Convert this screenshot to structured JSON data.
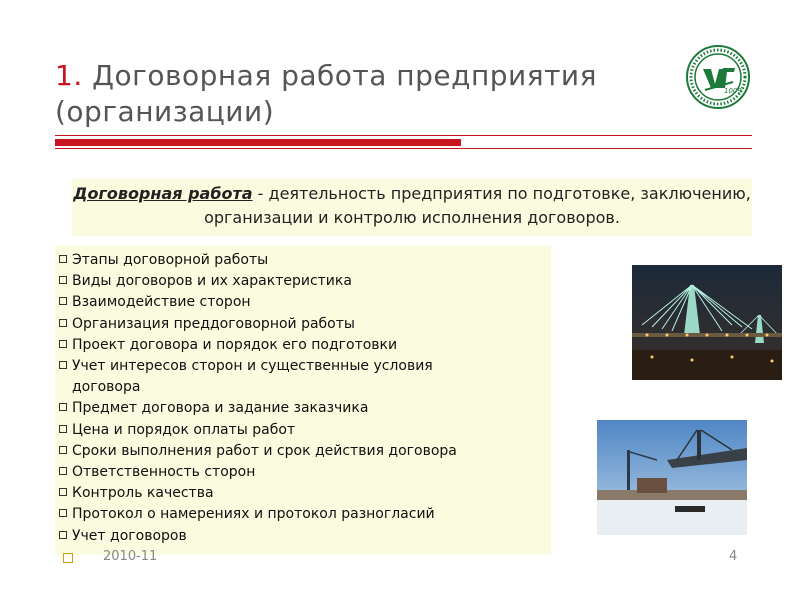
{
  "title": {
    "number": "1.",
    "text": "Договорная работа предприятия (организации)"
  },
  "logo": {
    "icon": "university-seal-logo",
    "letters": "УГ",
    "year": "1009",
    "colors": {
      "ring": "#1e7a3a",
      "letters": "#1e7a3a"
    }
  },
  "definition": {
    "term": "Договорная работа",
    "rest": " - деятельность предприятия по подготовке, заключению, организации и контролю исполнения договоров."
  },
  "list": {
    "items": [
      "Этапы договорной работы",
      "Виды договоров и их характеристика",
      "Взаимодействие сторон",
      "Организация преддоговорной работы",
      "Проект договора и порядок его подготовки",
      "Учет интересов сторон и существенные условия договора",
      "Предмет договора и задание заказчика",
      "Цена и порядок оплаты работ",
      "Сроки выполнения работ и срок действия договора",
      "Ответственность сторон",
      "Контроль качества",
      "Протокол о намерениях и протокол разногласий",
      "Учет договоров"
    ]
  },
  "footer": {
    "date": "2010-11",
    "page": "4"
  },
  "colors": {
    "accent": "#c8141e",
    "box_bg": "#fbfbe0",
    "title": "#555555"
  }
}
